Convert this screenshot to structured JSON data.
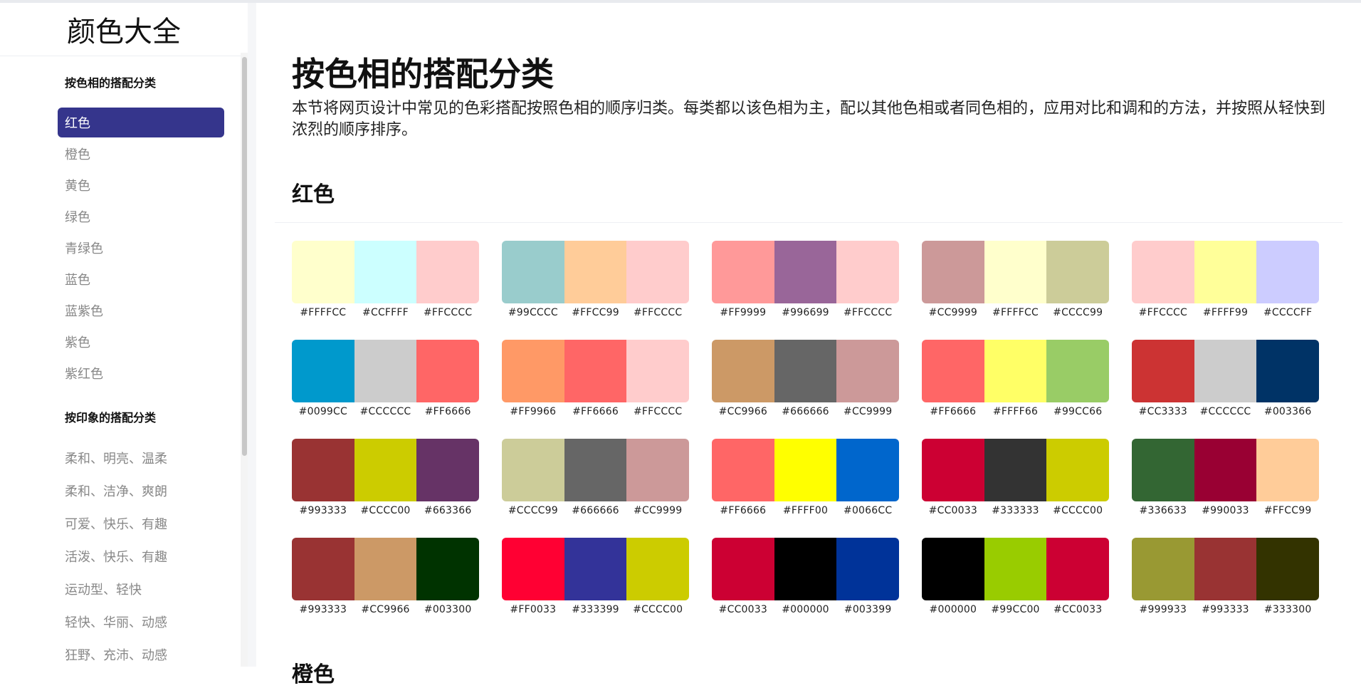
{
  "brand": "颜色大全",
  "sidebar": {
    "group1_title": "按色相的搭配分类",
    "hue_items": [
      "红色",
      "橙色",
      "黄色",
      "绿色",
      "青绿色",
      "蓝色",
      "蓝紫色",
      "紫色",
      "紫红色"
    ],
    "group2_title": "按印象的搭配分类",
    "mood_items": [
      "柔和、明亮、温柔",
      "柔和、洁净、爽朗",
      "可爱、快乐、有趣",
      "活泼、快乐、有趣",
      "运动型、轻快",
      "轻快、华丽、动感",
      "狂野、充沛、动感"
    ]
  },
  "main": {
    "title": "按色相的搭配分类",
    "description": "本节将网页设计中常见的色彩搭配按照色相的顺序归类。每类都以该色相为主，配以其他色相或者同色相的，应用对比和调和的方法，并按照从轻快到浓烈的顺序排序。",
    "section_title": "红色",
    "next_section_title": "橙色"
  },
  "palettes": [
    [
      "#FFFFCC",
      "#CCFFFF",
      "#FFCCCC"
    ],
    [
      "#99CCCC",
      "#FFCC99",
      "#FFCCCC"
    ],
    [
      "#FF9999",
      "#996699",
      "#FFCCCC"
    ],
    [
      "#CC9999",
      "#FFFFCC",
      "#CCCC99"
    ],
    [
      "#FFCCCC",
      "#FFFF99",
      "#CCCCFF"
    ],
    [
      "#0099CC",
      "#CCCCCC",
      "#FF6666"
    ],
    [
      "#FF9966",
      "#FF6666",
      "#FFCCCC"
    ],
    [
      "#CC9966",
      "#666666",
      "#CC9999"
    ],
    [
      "#FF6666",
      "#FFFF66",
      "#99CC66"
    ],
    [
      "#CC3333",
      "#CCCCCC",
      "#003366"
    ],
    [
      "#993333",
      "#CCCC00",
      "#663366"
    ],
    [
      "#CCCC99",
      "#666666",
      "#CC9999"
    ],
    [
      "#FF6666",
      "#FFFF00",
      "#0066CC"
    ],
    [
      "#CC0033",
      "#333333",
      "#CCCC00"
    ],
    [
      "#336633",
      "#990033",
      "#FFCC99"
    ],
    [
      "#993333",
      "#CC9966",
      "#003300"
    ],
    [
      "#FF0033",
      "#333399",
      "#CCCC00"
    ],
    [
      "#CC0033",
      "#000000",
      "#003399"
    ],
    [
      "#000000",
      "#99CC00",
      "#CC0033"
    ],
    [
      "#999933",
      "#993333",
      "#333300"
    ]
  ],
  "colors": {
    "active_nav_bg": "#35358c",
    "nav_text": "#888888"
  }
}
